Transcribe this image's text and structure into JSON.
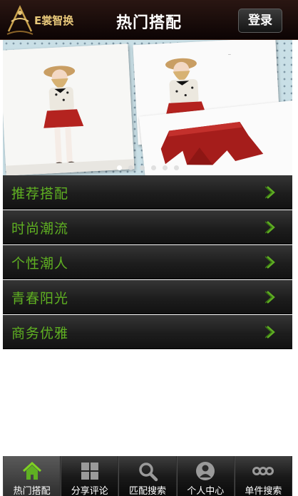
{
  "header": {
    "logo_text": "E裳智换",
    "title": "热门搭配",
    "login_label": "登录"
  },
  "banner": {
    "slide_count": 6,
    "active_index": 0
  },
  "menu": {
    "items": [
      {
        "label": "推荐搭配"
      },
      {
        "label": "时尚潮流"
      },
      {
        "label": "个性潮人"
      },
      {
        "label": "青春阳光"
      },
      {
        "label": "商务优雅"
      }
    ]
  },
  "tabs": [
    {
      "label": "热门搭配",
      "icon": "home-icon",
      "active": true
    },
    {
      "label": "分享评论",
      "icon": "grid-icon",
      "active": false
    },
    {
      "label": "匹配搜索",
      "icon": "search-icon",
      "active": false
    },
    {
      "label": "个人中心",
      "icon": "person-icon",
      "active": false
    },
    {
      "label": "单件搜索",
      "icon": "more-icon",
      "active": false
    }
  ],
  "colors": {
    "menu_text": "#5fb022",
    "logo_gold": "#e7c77a",
    "header_bg": "#1b0b08"
  }
}
